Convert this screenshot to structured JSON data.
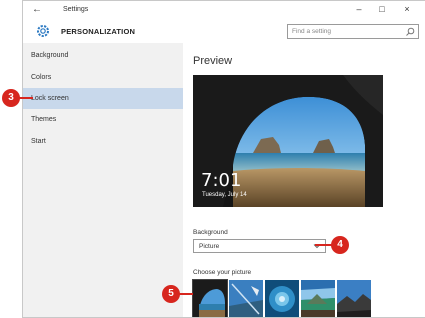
{
  "titlebar": {
    "back_icon": "back-arrow-icon",
    "title": "Settings",
    "minimize": "–",
    "maximize": "□",
    "close": "×"
  },
  "header": {
    "icon": "gear-icon",
    "title": "PERSONALIZATION",
    "search_placeholder": "Find a setting"
  },
  "sidebar": {
    "items": [
      {
        "label": "Background"
      },
      {
        "label": "Colors"
      },
      {
        "label": "Lock screen",
        "active": true
      },
      {
        "label": "Themes"
      },
      {
        "label": "Start"
      }
    ]
  },
  "main": {
    "preview_title": "Preview",
    "lock_time": "7:01",
    "lock_date": "Tuesday, July 14",
    "background_label": "Background",
    "background_value": "Picture",
    "choose_label": "Choose your picture"
  },
  "callouts": {
    "c3": "3",
    "c4": "4",
    "c5": "5"
  },
  "colors": {
    "accent_callout": "#d7261e",
    "active_nav": "#c8d8eb",
    "sidebar_bg": "#f1f1f1"
  }
}
